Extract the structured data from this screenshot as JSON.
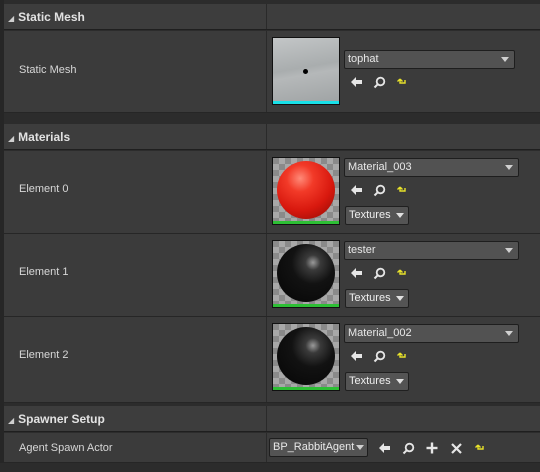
{
  "colors": {
    "mesh_bar": "#19e0e8",
    "material_bar": "#2dbf35",
    "red_sphere": "#e8281e",
    "black_sphere": "#111111",
    "reset_arrow": "#e8e22a"
  },
  "sections": {
    "static_mesh": {
      "title": "Static Mesh",
      "label": "Static Mesh",
      "asset": "tophat"
    },
    "materials": {
      "title": "Materials",
      "elements": [
        {
          "label": "Element 0",
          "asset": "Material_003",
          "textures": "Textures"
        },
        {
          "label": "Element 1",
          "asset": "tester",
          "textures": "Textures"
        },
        {
          "label": "Element 2",
          "asset": "Material_002",
          "textures": "Textures"
        }
      ]
    },
    "spawner_setup": {
      "title": "Spawner Setup",
      "label": "Agent Spawn Actor",
      "actor": "BP_RabbitAgent"
    }
  }
}
